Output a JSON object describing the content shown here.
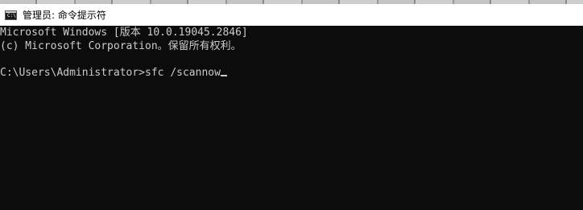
{
  "window": {
    "title": "管理员: 命令提示符",
    "icon": "cmd-icon"
  },
  "console": {
    "lines": [
      "Microsoft Windows [版本 10.0.19045.2846]",
      "(c) Microsoft Corporation。保留所有权利。",
      "",
      "C:\\Users\\Administrator>sfc /scannow"
    ]
  },
  "colors": {
    "console_bg": "#0c0c0c",
    "console_fg": "#cccccc",
    "titlebar_bg": "#ffffff"
  }
}
